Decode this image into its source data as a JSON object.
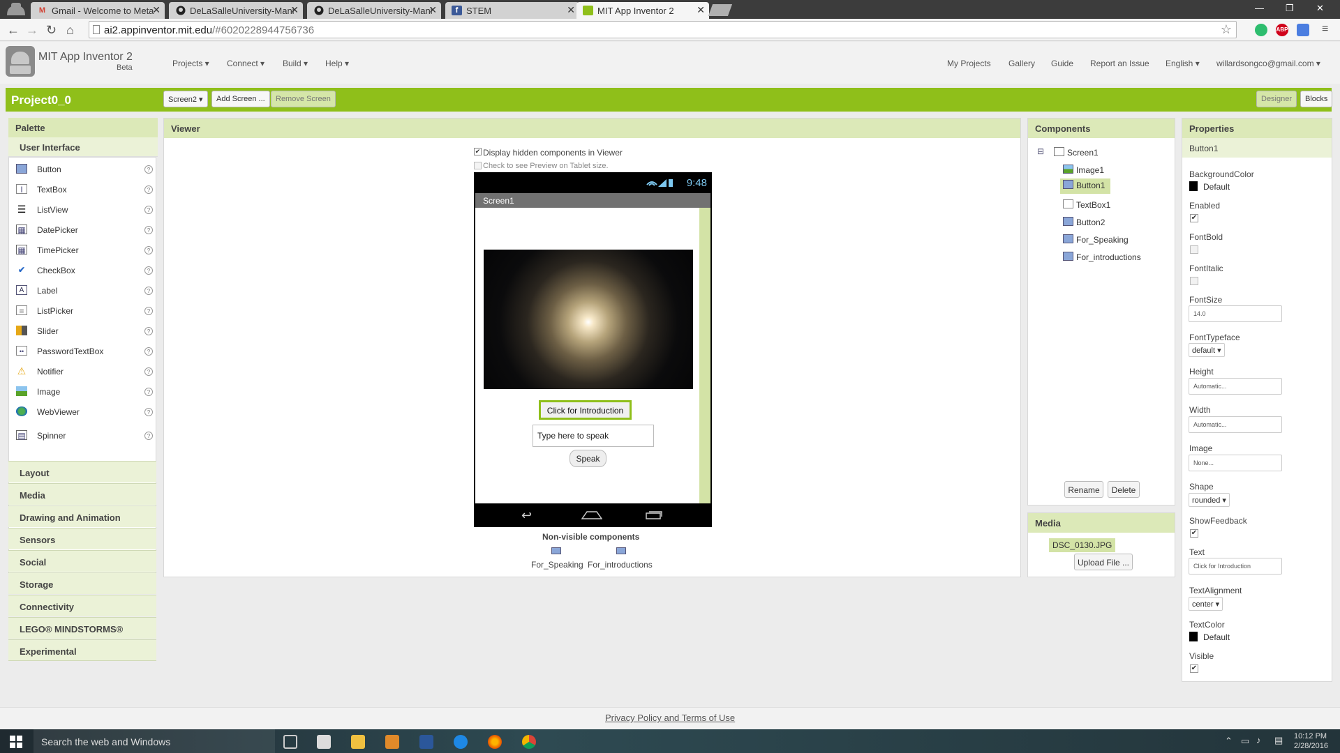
{
  "browser": {
    "tabs": [
      {
        "label": "Gmail - Welcome to Meta",
        "icon": "gmail-icon",
        "active": false
      },
      {
        "label": "DeLaSalleUniversity-Mani",
        "icon": "github-icon",
        "active": false
      },
      {
        "label": "DeLaSalleUniversity-Mani",
        "icon": "github-icon",
        "active": false
      },
      {
        "label": "STEM",
        "icon": "facebook-icon",
        "active": false
      },
      {
        "label": "MIT App Inventor 2",
        "icon": "appinventor-icon",
        "active": true
      }
    ],
    "url_host": "ai2.appinventor.mit.edu",
    "url_rest": "/#6020228944756736",
    "ext_badge": "ABP"
  },
  "app": {
    "name": "MIT App Inventor 2",
    "beta": "Beta",
    "menus": [
      "Projects ▾",
      "Connect ▾",
      "Build ▾",
      "Help ▾"
    ],
    "right_menus": [
      "My Projects",
      "Gallery",
      "Guide",
      "Report an Issue",
      "English ▾",
      "willardsongco@gmail.com ▾"
    ]
  },
  "project": {
    "name": "Project0_0",
    "screen_select": "Screen2 ▾",
    "add_screen": "Add Screen ...",
    "remove_screen": "Remove Screen",
    "designer": "Designer",
    "blocks": "Blocks"
  },
  "palette": {
    "title": "Palette",
    "section": "User Interface",
    "items": [
      {
        "label": "Button",
        "icon": "button-icon"
      },
      {
        "label": "TextBox",
        "icon": "textbox-icon"
      },
      {
        "label": "ListView",
        "icon": "listview-icon"
      },
      {
        "label": "DatePicker",
        "icon": "datepicker-icon"
      },
      {
        "label": "TimePicker",
        "icon": "timepicker-icon"
      },
      {
        "label": "CheckBox",
        "icon": "checkbox-icon"
      },
      {
        "label": "Label",
        "icon": "label-icon"
      },
      {
        "label": "ListPicker",
        "icon": "listpicker-icon"
      },
      {
        "label": "Slider",
        "icon": "slider-icon"
      },
      {
        "label": "PasswordTextBox",
        "icon": "password-icon"
      },
      {
        "label": "Notifier",
        "icon": "notifier-icon"
      },
      {
        "label": "Image",
        "icon": "image-icon"
      },
      {
        "label": "WebViewer",
        "icon": "webviewer-icon"
      },
      {
        "label": "Spinner",
        "icon": "spinner-icon"
      }
    ],
    "help_glyph": "?",
    "drawers": [
      "Layout",
      "Media",
      "Drawing and Animation",
      "Sensors",
      "Social",
      "Storage",
      "Connectivity",
      "LEGO® MINDSTORMS®",
      "Experimental"
    ]
  },
  "viewer": {
    "title": "Viewer",
    "display_hidden": "Display hidden components in Viewer",
    "tablet_preview": "Check to see Preview on Tablet size.",
    "phone_time": "9:48",
    "screen_title": "Screen1",
    "intro_button": "Click for Introduction",
    "textbox_text": "Type here to speak",
    "speak_button": "Speak",
    "nonvisible_title": "Non-visible components",
    "nonvisible": [
      "For_Speaking",
      "For_introductions"
    ]
  },
  "components": {
    "title": "Components",
    "root": "Screen1",
    "collapse_glyph": "⊟",
    "children": [
      "Image1",
      "Button1",
      "TextBox1",
      "Button2",
      "For_Speaking",
      "For_introductions"
    ],
    "selected": "Button1",
    "rename": "Rename",
    "delete": "Delete"
  },
  "media": {
    "title": "Media",
    "file": "DSC_0130.JPG",
    "upload": "Upload File ..."
  },
  "properties": {
    "title": "Properties",
    "component": "Button1",
    "background_color_label": "BackgroundColor",
    "background_color": "Default",
    "enabled_label": "Enabled",
    "enabled": true,
    "fontbold_label": "FontBold",
    "fontbold": false,
    "fontitalic_label": "FontItalic",
    "fontitalic": false,
    "fontsize_label": "FontSize",
    "fontsize": "14.0",
    "fonttypeface_label": "FontTypeface",
    "fonttypeface": "default ▾",
    "height_label": "Height",
    "height": "Automatic...",
    "width_label": "Width",
    "width": "Automatic...",
    "image_label": "Image",
    "image": "None...",
    "shape_label": "Shape",
    "shape": "rounded ▾",
    "showfeedback_label": "ShowFeedback",
    "showfeedback": true,
    "text_label": "Text",
    "text": "Click for Introduction",
    "textalignment_label": "TextAlignment",
    "textalignment": "center ▾",
    "textcolor_label": "TextColor",
    "textcolor": "Default",
    "visible_label": "Visible",
    "visible": true
  },
  "footer": {
    "privacy": "Privacy Policy and Terms of Use"
  },
  "taskbar": {
    "search": "Search the web and Windows",
    "time": "10:12 PM",
    "date": "2/28/2016"
  },
  "colors": {
    "accent_green": "#8fbf1a",
    "panel_header": "#dce9b8"
  }
}
